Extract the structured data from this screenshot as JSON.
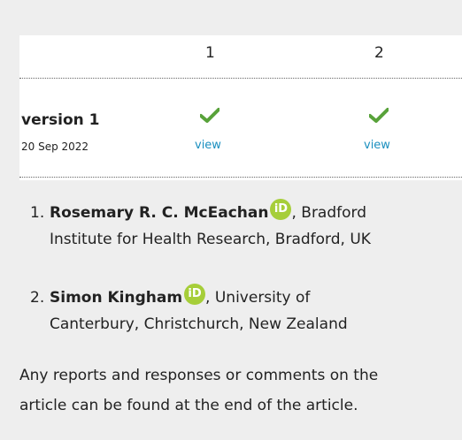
{
  "table": {
    "columns": [
      "1",
      "2"
    ],
    "version": {
      "label": "version 1",
      "date": "20 Sep 2022"
    },
    "cells": [
      {
        "status": "approved",
        "status_icon": "check-icon",
        "link": "view",
        "color": "#58a23a"
      },
      {
        "status": "approved",
        "status_icon": "check-icon",
        "link": "view",
        "color": "#58a23a"
      }
    ]
  },
  "authors": [
    {
      "number": "1.",
      "name": "Rosemary R. C. McEachan",
      "orcid_icon": "orcid-icon",
      "orcid_text": "iD",
      "affiliation_line1": ", Bradford",
      "affiliation_line2": "Institute for Health Research, Bradford, UK"
    },
    {
      "number": "2.",
      "name": "Simon Kingham",
      "orcid_icon": "orcid-icon",
      "orcid_text": "iD",
      "affiliation_line1": ", University of",
      "affiliation_line2": "Canterbury, Christchurch, New Zealand"
    }
  ],
  "footer": {
    "line1": "Any reports and responses or comments on the",
    "line2": "article can be found at the end of the article."
  },
  "colors": {
    "link": "#1a8fbf",
    "check": "#58a23a",
    "orcid": "#a6ce39"
  }
}
